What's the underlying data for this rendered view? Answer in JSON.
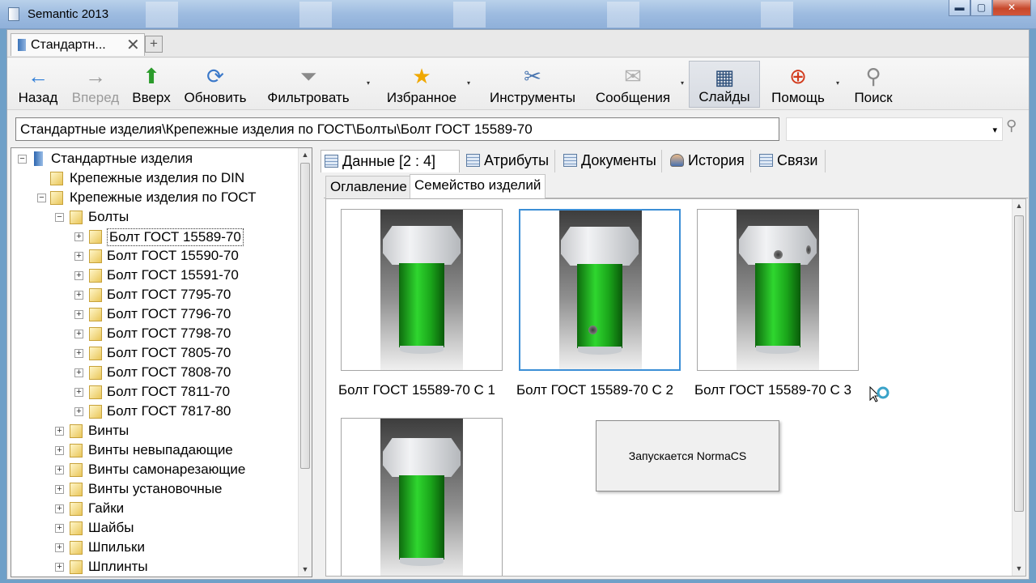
{
  "window": {
    "title": "Semantic 2013",
    "minimize": "▬",
    "maximize": "▢",
    "close": "✕"
  },
  "doc_tab": {
    "label": "Стандартн...",
    "close": "✕",
    "add": "+"
  },
  "toolbar": {
    "back": "Назад",
    "forward": "Вперед",
    "up": "Вверх",
    "refresh": "Обновить",
    "filter": "Фильтровать",
    "favorites": "Избранное",
    "tools": "Инструменты",
    "messages": "Сообщения",
    "slides": "Слайды",
    "help": "Помощь",
    "search": "Поиск"
  },
  "icons": {
    "back": "←",
    "forward": "→",
    "up": "⬆",
    "refresh": "⟳",
    "filter": "⏷",
    "favorites": "★",
    "tools": "✂",
    "messages": "✉",
    "slides": "▦",
    "help": "⊕",
    "search": "⚲",
    "dropdown": "▾"
  },
  "address": {
    "path": "Стандартные изделия\\Крепежные изделия по ГОСТ\\Болты\\Болт ГОСТ 15589-70"
  },
  "tree": {
    "root": "Стандартные изделия",
    "din": "Крепежные изделия по DIN",
    "gost": "Крепежные изделия по ГОСТ",
    "bolts": "Болты",
    "bolt_items": [
      "Болт ГОСТ 15589-70",
      "Болт ГОСТ 15590-70",
      "Болт ГОСТ 15591-70",
      "Болт ГОСТ 7795-70",
      "Болт ГОСТ 7796-70",
      "Болт ГОСТ 7798-70",
      "Болт ГОСТ 7805-70",
      "Болт ГОСТ 7808-70",
      "Болт ГОСТ 7811-70",
      "Болт ГОСТ 7817-80"
    ],
    "other_groups": [
      "Винты",
      "Винты невыпадающие",
      "Винты самонарезающие",
      "Винты установочные",
      "Гайки",
      "Шайбы",
      "Шпильки",
      "Шплинты"
    ]
  },
  "tabs": {
    "data": "Данные [2 : 4]",
    "attributes": "Атрибуты",
    "documents": "Документы",
    "history": "История",
    "links": "Связи"
  },
  "subtabs": {
    "contents": "Оглавление",
    "family": "Семейство изделий"
  },
  "items": {
    "c1": "Болт ГОСТ 15589-70 С 1",
    "c2": "Болт ГОСТ 15589-70 С 2",
    "c3": "Болт ГОСТ 15589-70 С 3"
  },
  "popup": {
    "message": "Запускается NormaCS"
  },
  "colors": {
    "selection": "#3c8fd6",
    "bolt_green": "#1aa51a",
    "close_red": "#c7482b"
  }
}
